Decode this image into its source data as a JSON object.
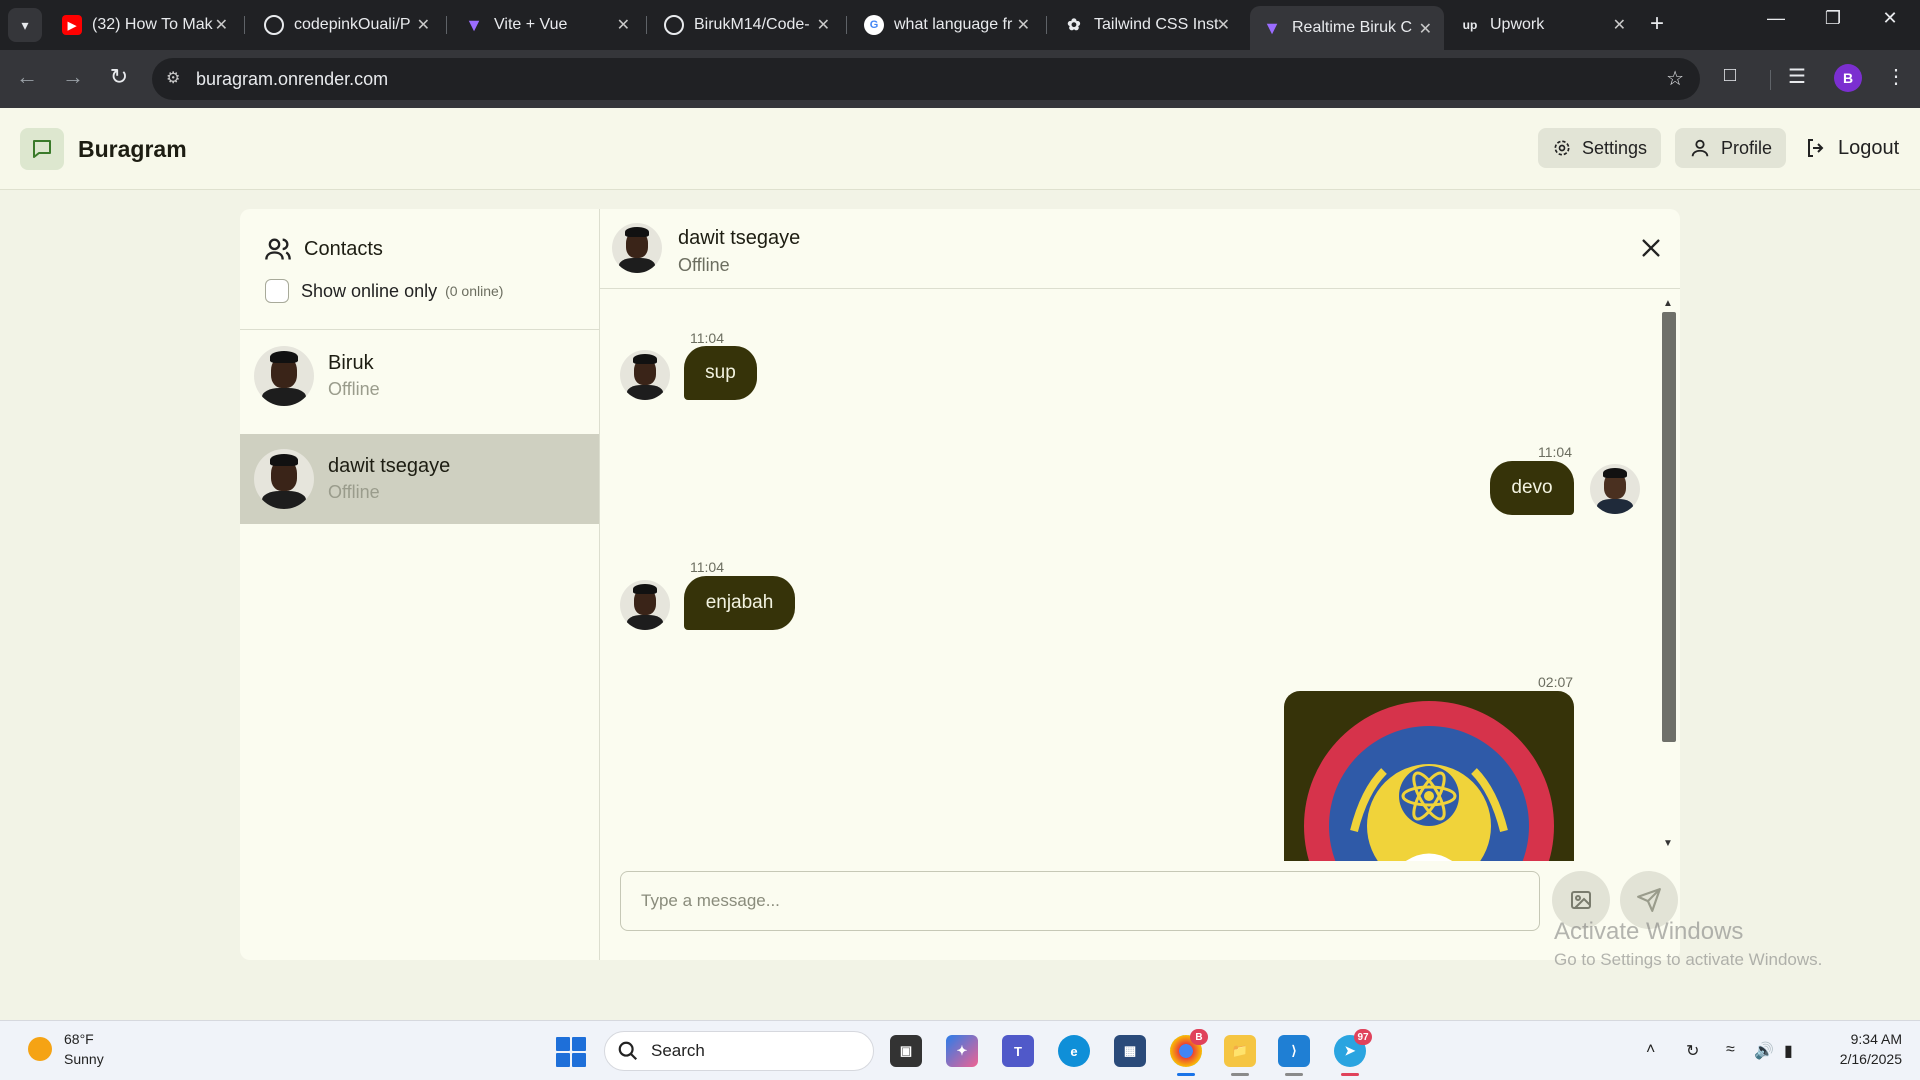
{
  "browser": {
    "tabs": [
      {
        "label": "(32) How To Mak",
        "icon": "youtube-icon",
        "color": "#ff0000"
      },
      {
        "label": "codepinkOuali/P",
        "icon": "github-icon",
        "color": "#ffffff"
      },
      {
        "label": "Vite + Vue",
        "icon": "vite-icon",
        "color": "#9b6cff"
      },
      {
        "label": "BirukM14/Code-",
        "icon": "github-icon",
        "color": "#ffffff"
      },
      {
        "label": "what language fr",
        "icon": "google-icon",
        "color": "#4285f4"
      },
      {
        "label": "Tailwind CSS Inst",
        "icon": "chatgpt-icon",
        "color": "#ffffff"
      },
      {
        "label": "Realtime Biruk C",
        "icon": "vite-icon",
        "color": "#9b6cff"
      },
      {
        "label": "Upwork",
        "icon": "upwork-icon",
        "color": "#ffffff"
      }
    ],
    "active_tab_index": 6,
    "url": "buragram.onrender.com",
    "profile_initial": "B"
  },
  "app": {
    "brand": "Buragram",
    "settings_label": "Settings",
    "profile_label": "Profile",
    "logout_label": "Logout"
  },
  "sidebar": {
    "title": "Contacts",
    "filter_label": "Show online only",
    "online_count": "(0 online)",
    "contacts": [
      {
        "name": "Biruk",
        "status": "Offline",
        "selected": false
      },
      {
        "name": "dawit tsegaye",
        "status": "Offline",
        "selected": true
      }
    ]
  },
  "chat": {
    "name": "dawit tsegaye",
    "status": "Offline",
    "messages": [
      {
        "time": "11:04",
        "text": "sup",
        "side": "left"
      },
      {
        "time": "11:04",
        "text": "devo",
        "side": "right"
      },
      {
        "time": "11:04",
        "text": "enjabah",
        "side": "left"
      },
      {
        "time": "02:07",
        "text": "",
        "side": "right",
        "type": "image"
      }
    ],
    "input_placeholder": "Type a message..."
  },
  "watermark": {
    "line1": "Activate Windows",
    "line2": "Go to Settings to activate Windows."
  },
  "taskbar": {
    "weather_temp": "68°F",
    "weather_desc": "Sunny",
    "search_label": "Search",
    "time": "9:34 AM",
    "date": "2/16/2025",
    "chrome_badge": "B",
    "telegram_badge": "97"
  },
  "colors": {
    "bubble": "#363309",
    "app_bg": "#f2f3e6",
    "card_bg": "#fbfcf0",
    "selected_contact": "#cfd0c1"
  }
}
